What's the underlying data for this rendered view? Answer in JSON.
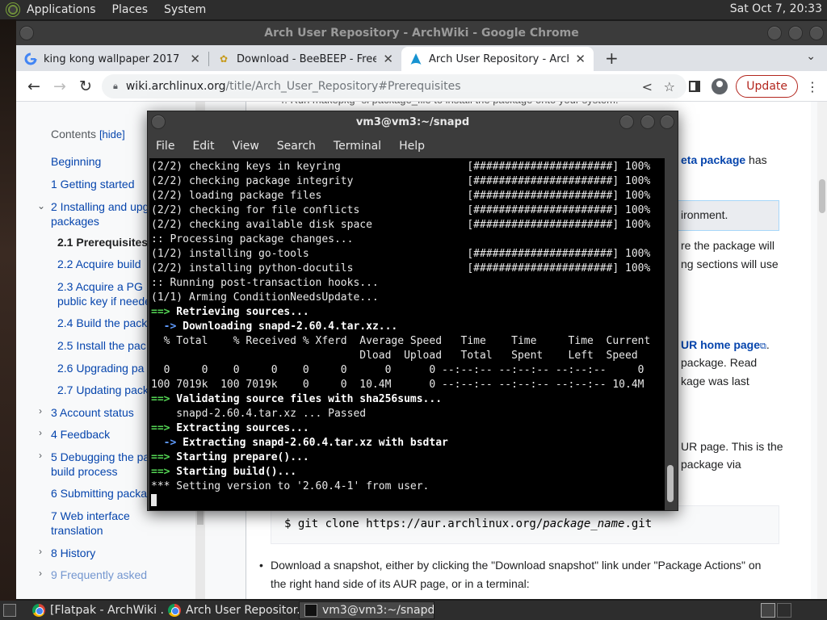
{
  "top_panel": {
    "menus": [
      "Applications",
      "Places",
      "System"
    ],
    "clock": "Sat Oct  7, 20:33"
  },
  "chrome": {
    "window_title": "Arch User Repository - ArchWiki - Google Chrome",
    "tabs": [
      {
        "label": "king kong wallpaper 2017 - Go",
        "icon": "google-g-icon"
      },
      {
        "label": "Download - BeeBEEP - Free C",
        "icon": "beebeep-icon"
      },
      {
        "label": "Arch User Repository - ArchW",
        "icon": "arch-logo-icon"
      }
    ],
    "url_host": "wiki.archlinux.org",
    "url_path": "/title/Arch_User_Repository#Prerequisites",
    "update_label": "Update"
  },
  "wiki": {
    "toc_title": "Contents",
    "toc_hide": "[hide]",
    "toc": [
      "Beginning",
      "1  Getting started",
      "2  Installing and upg",
      "packages",
      "2.1  Prerequisites",
      "2.2  Acquire build",
      "2.3  Acquire a PG",
      "public key if neede",
      "2.4  Build the pack",
      "2.5  Install the pac",
      "2.6  Upgrading pa",
      "2.7  Updating pack",
      "3  Account status",
      "4  Feedback",
      "5  Debugging the pa",
      "build process",
      "6  Submitting packa",
      "7  Web interface",
      "translation",
      "8  History",
      "9  Frequently asked"
    ],
    "content": {
      "top_fragment": "4. Run  makepkg -si package_file  to install the package onto your system.",
      "meta_package": "eta package",
      "has": " has",
      "environment": "ironment.",
      "line_pkg_will": "re the package will",
      "line_sections": "ng sections will use",
      "aur_home": "UR home page",
      "line_read": " package. Read",
      "line_last": "kage was last",
      "line_aur_page": "UR page. This is the",
      "line_via": " package via",
      "code_prefix": "$ git clone https://aur.archlinux.org/",
      "code_italic": "package_name",
      "code_suffix": ".git",
      "bullet_line1": "Download a snapshot, either by clicking the \"Download snapshot\" link under \"Package Actions\" on",
      "bullet_line2": "the right hand side of its AUR page, or in a terminal:"
    }
  },
  "terminal": {
    "title": "vm3@vm3:~/snapd",
    "menu": [
      "File",
      "Edit",
      "View",
      "Search",
      "Terminal",
      "Help"
    ],
    "lines": [
      {
        "text": "(2/2) checking keys in keyring                    [######################] 100%",
        "style": "normal"
      },
      {
        "text": "(2/2) checking package integrity                  [######################] 100%",
        "style": "normal"
      },
      {
        "text": "(2/2) loading package files                       [######################] 100%",
        "style": "normal"
      },
      {
        "text": "(2/2) checking for file conflicts                 [######################] 100%",
        "style": "normal"
      },
      {
        "text": "(2/2) checking available disk space               [######################] 100%",
        "style": "normal"
      },
      {
        "text": ":: Processing package changes...",
        "style": "normal"
      },
      {
        "text": "(1/2) installing go-tools                         [######################] 100%",
        "style": "normal"
      },
      {
        "text": "(2/2) installing python-docutils                  [######################] 100%",
        "style": "normal"
      },
      {
        "text": ":: Running post-transaction hooks...",
        "style": "normal"
      },
      {
        "text": "(1/1) Arming ConditionNeedsUpdate...",
        "style": "normal"
      },
      {
        "prefix": "==>",
        "text": " Retrieving sources...",
        "style": "green"
      },
      {
        "prefix": "  ->",
        "text": " Downloading snapd-2.60.4.tar.xz...",
        "style": "blue"
      },
      {
        "text": "  % Total    % Received % Xferd  Average Speed   Time    Time     Time  Current",
        "style": "normal"
      },
      {
        "text": "                                 Dload  Upload   Total   Spent    Left  Speed",
        "style": "normal"
      },
      {
        "text": "  0     0    0     0    0     0      0      0 --:--:-- --:--:-- --:--:--     0",
        "style": "normal"
      },
      {
        "text": "100 7019k  100 7019k    0     0  10.4M      0 --:--:-- --:--:-- --:--:-- 10.4M",
        "style": "normal"
      },
      {
        "prefix": "==>",
        "text": " Validating source files with sha256sums...",
        "style": "green"
      },
      {
        "text": "    snapd-2.60.4.tar.xz ... Passed",
        "style": "normal"
      },
      {
        "prefix": "==>",
        "text": " Extracting sources...",
        "style": "green"
      },
      {
        "prefix": "  ->",
        "text": " Extracting snapd-2.60.4.tar.xz with bsdtar",
        "style": "blue"
      },
      {
        "prefix": "==>",
        "text": " Starting prepare()...",
        "style": "green"
      },
      {
        "prefix": "==>",
        "text": " Starting build()...",
        "style": "green"
      },
      {
        "text": "*** Setting version to '2.60.4-1' from user.",
        "style": "normal"
      }
    ]
  },
  "taskbar": {
    "tasks": [
      {
        "label": "[Flatpak - ArchWiki ...",
        "icon": "chrome-icon"
      },
      {
        "label": "Arch User Repositor...",
        "icon": "chrome-icon"
      },
      {
        "label": "vm3@vm3:~/snapd",
        "icon": "terminal-icon"
      }
    ]
  }
}
